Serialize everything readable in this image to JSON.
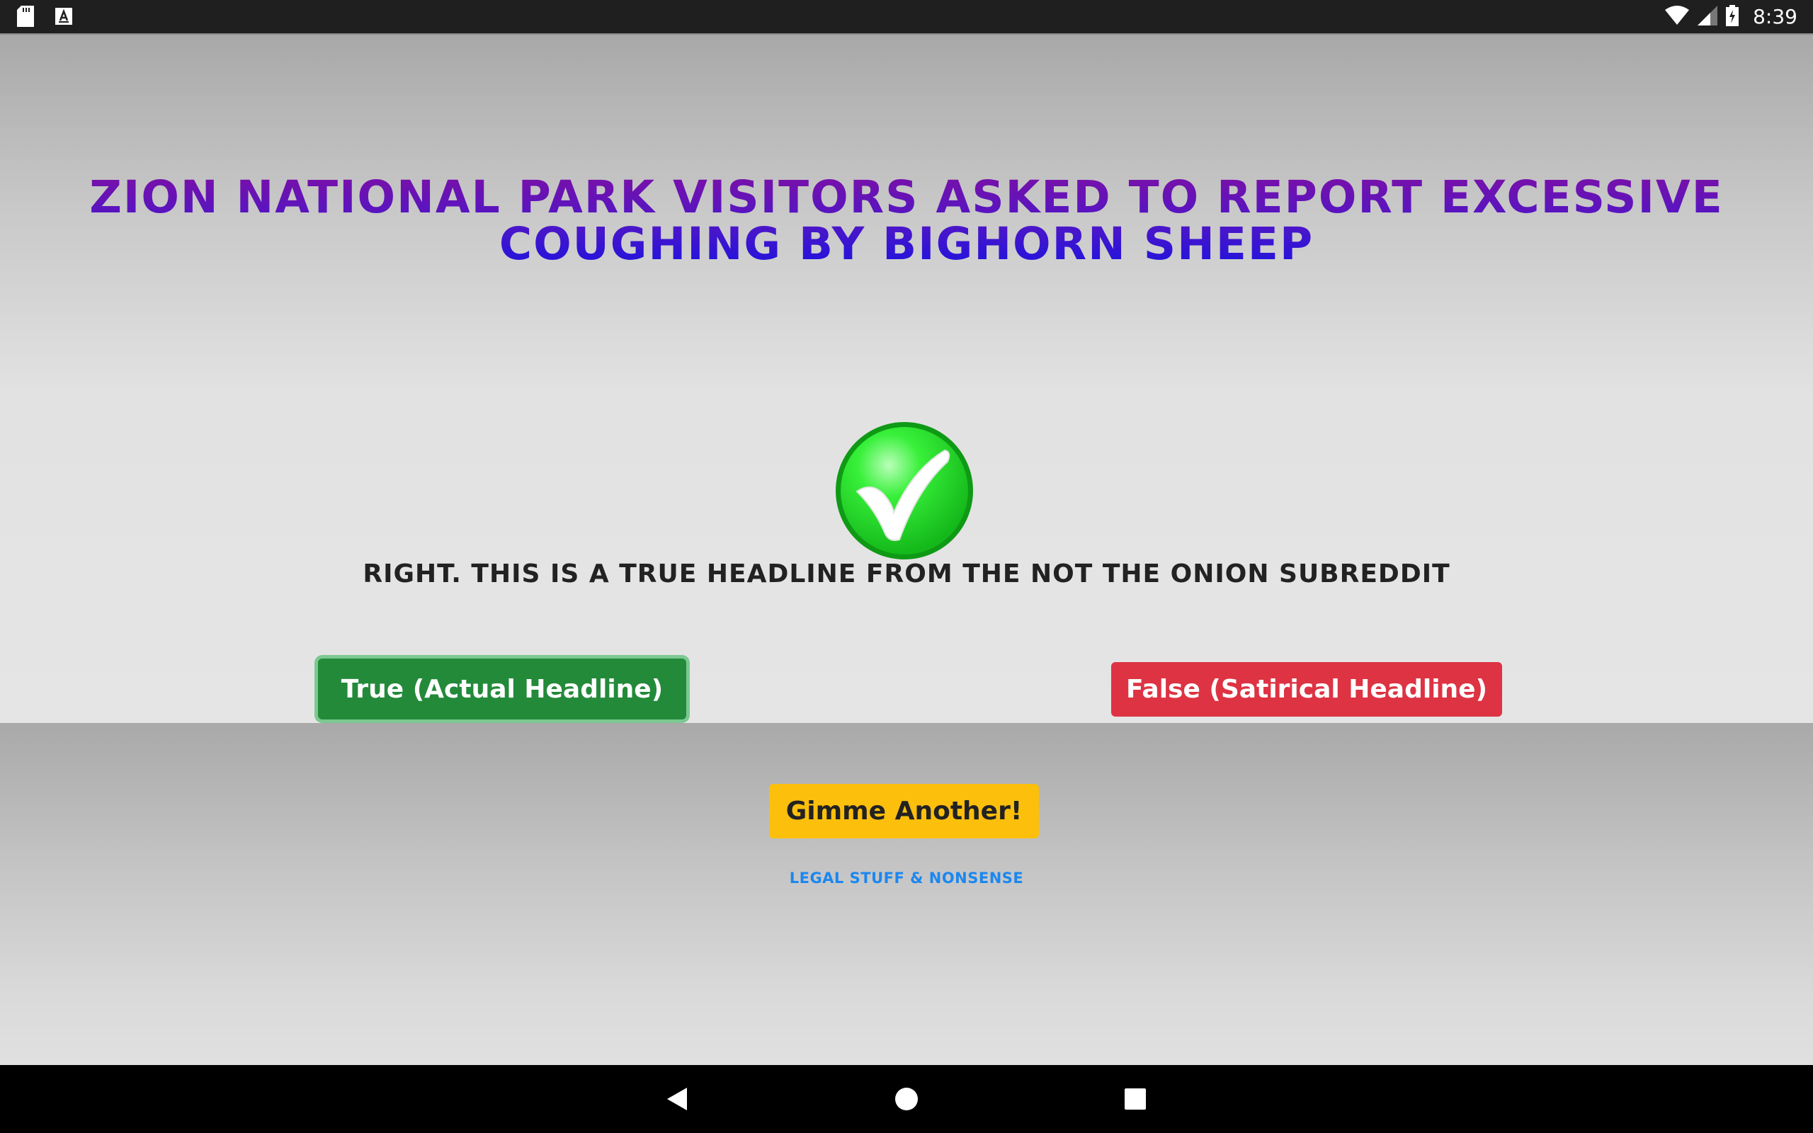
{
  "status_bar": {
    "clock": "8:39",
    "left_icons": [
      "sd-card-icon",
      "text-a-icon"
    ],
    "right_icons": [
      "wifi-icon",
      "signal-icon",
      "battery-charging-icon"
    ]
  },
  "headline": "Zion National Park visitors asked to report excessive coughing by bighorn sheep",
  "result": {
    "icon": "check-circle-icon",
    "text": "Right. This is a true headline from the Not the Onion subreddit",
    "correct": true
  },
  "answers": {
    "true_label": "True (Actual Headline)",
    "false_label": "False (Satirical Headline)"
  },
  "gimme_label": "Gimme Another!",
  "legal_label": "Legal stuff & nonsense",
  "colors": {
    "true_button": "#238a3a",
    "false_button": "#dd3343",
    "gimme_button": "#fcbf0c",
    "link": "#1b87f0",
    "headline_top": "#7a10a8",
    "headline_bottom": "#1f13de"
  },
  "nav_bar": {
    "buttons": [
      "back-icon",
      "home-icon",
      "recents-icon"
    ]
  }
}
